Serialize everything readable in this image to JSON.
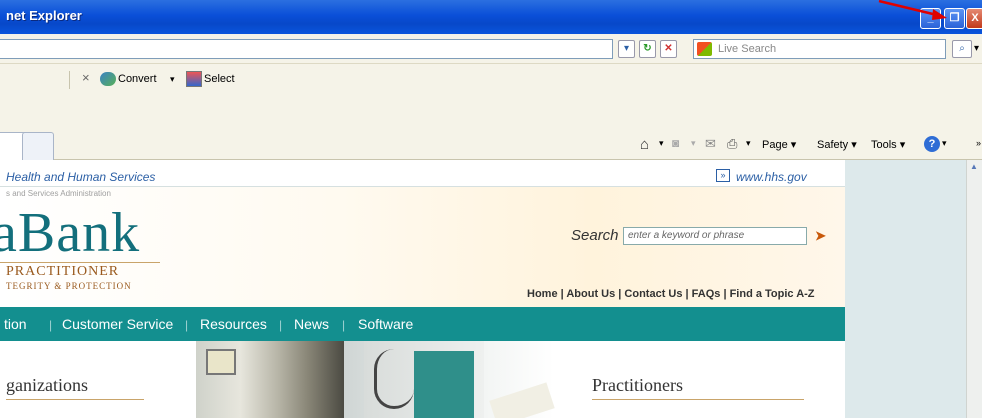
{
  "window": {
    "title": "net Explorer",
    "buttons": {
      "minimize": "_",
      "restore": "❐",
      "close": "X"
    }
  },
  "address": {
    "value": "",
    "search_placeholder": "Live Search"
  },
  "toolbar": {
    "convert_label": "Convert",
    "select_label": "Select",
    "x_label": "×"
  },
  "command_bar": {
    "page_label": "Page",
    "safety_label": "Safety",
    "tools_label": "Tools"
  },
  "page": {
    "hhs_text": "Health and Human Services",
    "hrsa_text": "s and Services Administration",
    "hhs_url": "www.hhs.gov",
    "logo_text": "aBank",
    "logo_sub1": "PRACTITIONER",
    "logo_sub2": "TEGRITY & PROTECTION",
    "search_label": "Search",
    "search_placeholder": "enter a keyword or phrase",
    "top_links": "Home | About Us | Contact Us | FAQs | Find a Topic A-Z",
    "nav": [
      {
        "label": "tion"
      },
      {
        "label": "Customer Service"
      },
      {
        "label": "Resources"
      },
      {
        "label": "News"
      },
      {
        "label": "Software"
      }
    ],
    "org_title": "ganizations",
    "prac_title": "Practitioners"
  },
  "colors": {
    "titlebar": "#0a4fd8",
    "nav_bar": "#138f8f",
    "logo": "#136f7c",
    "accent": "#c8590b",
    "annotation_arrow": "#e00000"
  }
}
